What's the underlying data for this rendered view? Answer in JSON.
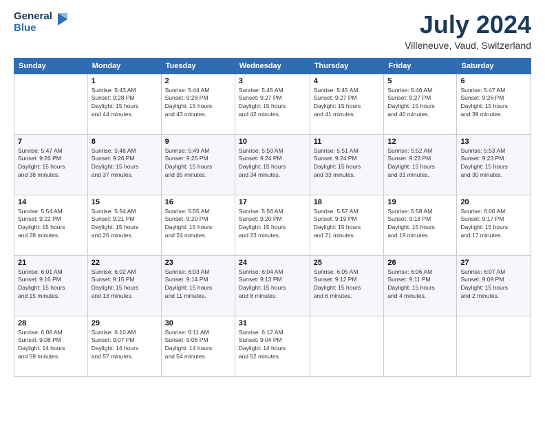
{
  "header": {
    "logo_line1": "General",
    "logo_line2": "Blue",
    "month_year": "July 2024",
    "location": "Villeneuve, Vaud, Switzerland"
  },
  "columns": [
    "Sunday",
    "Monday",
    "Tuesday",
    "Wednesday",
    "Thursday",
    "Friday",
    "Saturday"
  ],
  "weeks": [
    [
      {
        "day": "",
        "info": ""
      },
      {
        "day": "1",
        "info": "Sunrise: 5:43 AM\nSunset: 9:28 PM\nDaylight: 15 hours\nand 44 minutes."
      },
      {
        "day": "2",
        "info": "Sunrise: 5:44 AM\nSunset: 9:28 PM\nDaylight: 15 hours\nand 43 minutes."
      },
      {
        "day": "3",
        "info": "Sunrise: 5:45 AM\nSunset: 9:27 PM\nDaylight: 15 hours\nand 42 minutes."
      },
      {
        "day": "4",
        "info": "Sunrise: 5:45 AM\nSunset: 9:27 PM\nDaylight: 15 hours\nand 41 minutes."
      },
      {
        "day": "5",
        "info": "Sunrise: 5:46 AM\nSunset: 9:27 PM\nDaylight: 15 hours\nand 40 minutes."
      },
      {
        "day": "6",
        "info": "Sunrise: 5:47 AM\nSunset: 9:26 PM\nDaylight: 15 hours\nand 39 minutes."
      }
    ],
    [
      {
        "day": "7",
        "info": "Sunrise: 5:47 AM\nSunset: 9:26 PM\nDaylight: 15 hours\nand 38 minutes."
      },
      {
        "day": "8",
        "info": "Sunrise: 5:48 AM\nSunset: 9:26 PM\nDaylight: 15 hours\nand 37 minutes."
      },
      {
        "day": "9",
        "info": "Sunrise: 5:49 AM\nSunset: 9:25 PM\nDaylight: 15 hours\nand 35 minutes."
      },
      {
        "day": "10",
        "info": "Sunrise: 5:50 AM\nSunset: 9:24 PM\nDaylight: 15 hours\nand 34 minutes."
      },
      {
        "day": "11",
        "info": "Sunrise: 5:51 AM\nSunset: 9:24 PM\nDaylight: 15 hours\nand 33 minutes."
      },
      {
        "day": "12",
        "info": "Sunrise: 5:52 AM\nSunset: 9:23 PM\nDaylight: 15 hours\nand 31 minutes."
      },
      {
        "day": "13",
        "info": "Sunrise: 5:53 AM\nSunset: 9:23 PM\nDaylight: 15 hours\nand 30 minutes."
      }
    ],
    [
      {
        "day": "14",
        "info": "Sunrise: 5:54 AM\nSunset: 9:22 PM\nDaylight: 15 hours\nand 28 minutes."
      },
      {
        "day": "15",
        "info": "Sunrise: 5:54 AM\nSunset: 9:21 PM\nDaylight: 15 hours\nand 26 minutes."
      },
      {
        "day": "16",
        "info": "Sunrise: 5:55 AM\nSunset: 9:20 PM\nDaylight: 15 hours\nand 24 minutes."
      },
      {
        "day": "17",
        "info": "Sunrise: 5:56 AM\nSunset: 9:20 PM\nDaylight: 15 hours\nand 23 minutes."
      },
      {
        "day": "18",
        "info": "Sunrise: 5:57 AM\nSunset: 9:19 PM\nDaylight: 15 hours\nand 21 minutes."
      },
      {
        "day": "19",
        "info": "Sunrise: 5:58 AM\nSunset: 9:18 PM\nDaylight: 15 hours\nand 19 minutes."
      },
      {
        "day": "20",
        "info": "Sunrise: 6:00 AM\nSunset: 9:17 PM\nDaylight: 15 hours\nand 17 minutes."
      }
    ],
    [
      {
        "day": "21",
        "info": "Sunrise: 6:01 AM\nSunset: 9:16 PM\nDaylight: 15 hours\nand 15 minutes."
      },
      {
        "day": "22",
        "info": "Sunrise: 6:02 AM\nSunset: 9:15 PM\nDaylight: 15 hours\nand 13 minutes."
      },
      {
        "day": "23",
        "info": "Sunrise: 6:03 AM\nSunset: 9:14 PM\nDaylight: 15 hours\nand 11 minutes."
      },
      {
        "day": "24",
        "info": "Sunrise: 6:04 AM\nSunset: 9:13 PM\nDaylight: 15 hours\nand 8 minutes."
      },
      {
        "day": "25",
        "info": "Sunrise: 6:05 AM\nSunset: 9:12 PM\nDaylight: 15 hours\nand 6 minutes."
      },
      {
        "day": "26",
        "info": "Sunrise: 6:06 AM\nSunset: 9:11 PM\nDaylight: 15 hours\nand 4 minutes."
      },
      {
        "day": "27",
        "info": "Sunrise: 6:07 AM\nSunset: 9:09 PM\nDaylight: 15 hours\nand 2 minutes."
      }
    ],
    [
      {
        "day": "28",
        "info": "Sunrise: 6:08 AM\nSunset: 9:08 PM\nDaylight: 14 hours\nand 59 minutes."
      },
      {
        "day": "29",
        "info": "Sunrise: 6:10 AM\nSunset: 9:07 PM\nDaylight: 14 hours\nand 57 minutes."
      },
      {
        "day": "30",
        "info": "Sunrise: 6:11 AM\nSunset: 9:06 PM\nDaylight: 14 hours\nand 54 minutes."
      },
      {
        "day": "31",
        "info": "Sunrise: 6:12 AM\nSunset: 9:04 PM\nDaylight: 14 hours\nand 52 minutes."
      },
      {
        "day": "",
        "info": ""
      },
      {
        "day": "",
        "info": ""
      },
      {
        "day": "",
        "info": ""
      }
    ]
  ]
}
